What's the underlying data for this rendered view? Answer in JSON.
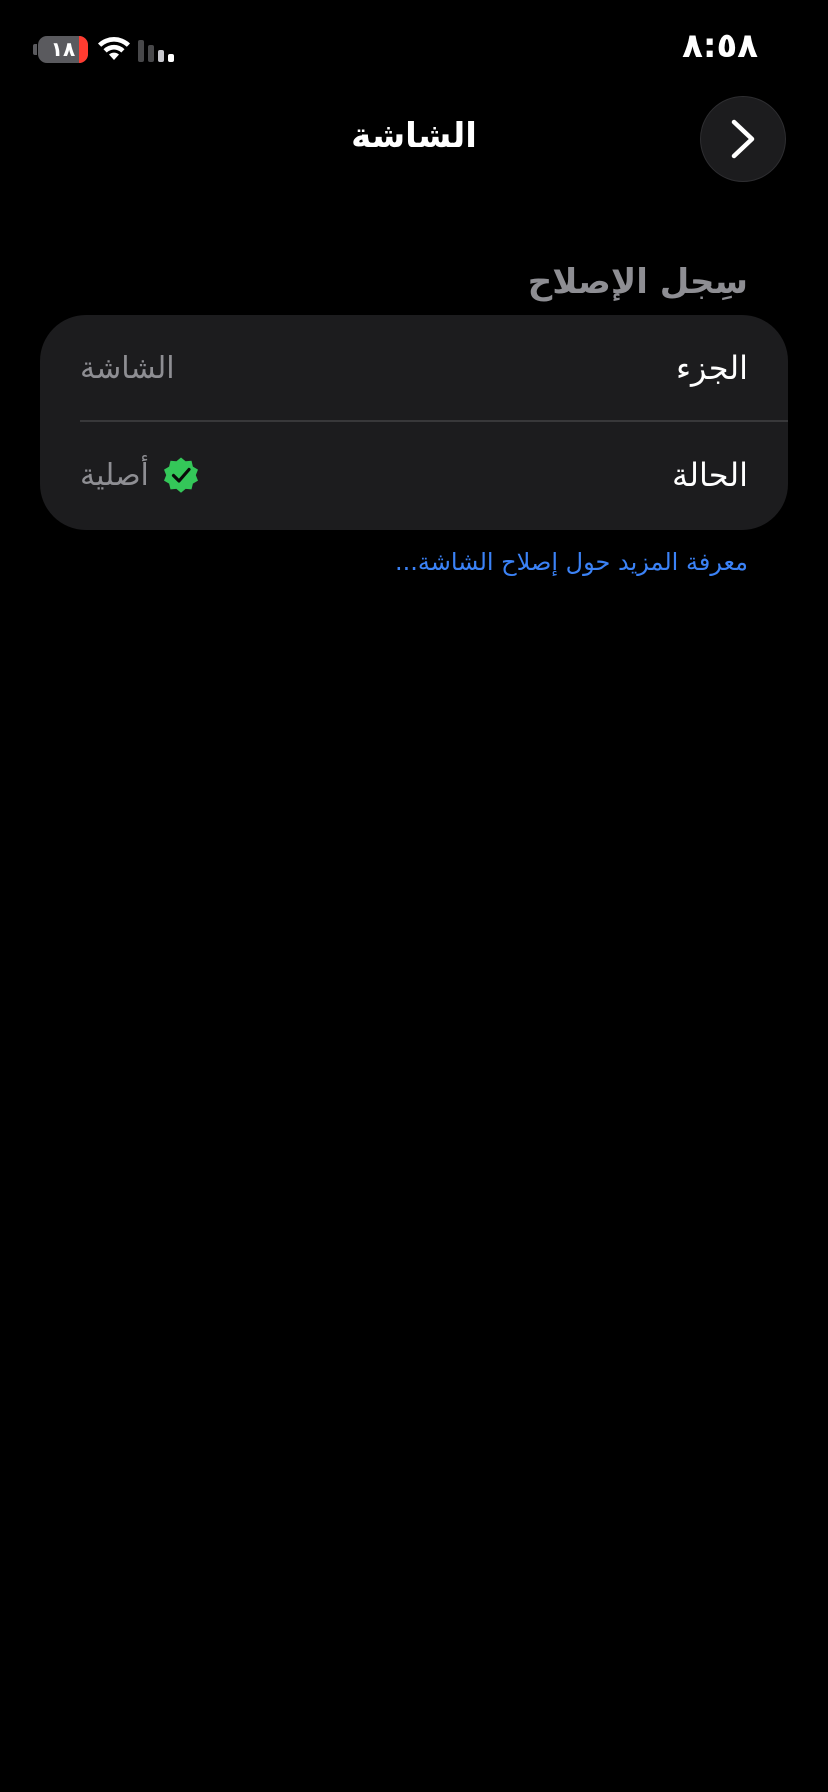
{
  "status_bar": {
    "time": "٨:٥٨",
    "battery_level": "١٨",
    "battery_fraction": 0.18
  },
  "nav": {
    "title": "الشاشة"
  },
  "section": {
    "header": "سِجل الإصلاح"
  },
  "card": {
    "rows": [
      {
        "label": "الجزء",
        "value": "الشاشة"
      },
      {
        "label": "الحالة",
        "value": "أصلية"
      }
    ]
  },
  "link": {
    "learn_more": "معرفة المزيد حول إصلاح الشاشة..."
  },
  "icons": {
    "back": "chevron-right-icon",
    "verified": "verified-badge-icon",
    "wifi": "wifi-icon",
    "signal": "signal-icon",
    "battery": "battery-icon"
  },
  "colors": {
    "background": "#000000",
    "card": "#1c1c1e",
    "secondary_text": "#8e8e93",
    "link": "#3b82f6",
    "verified": "#34c759",
    "battery_low": "#ff3b30"
  }
}
